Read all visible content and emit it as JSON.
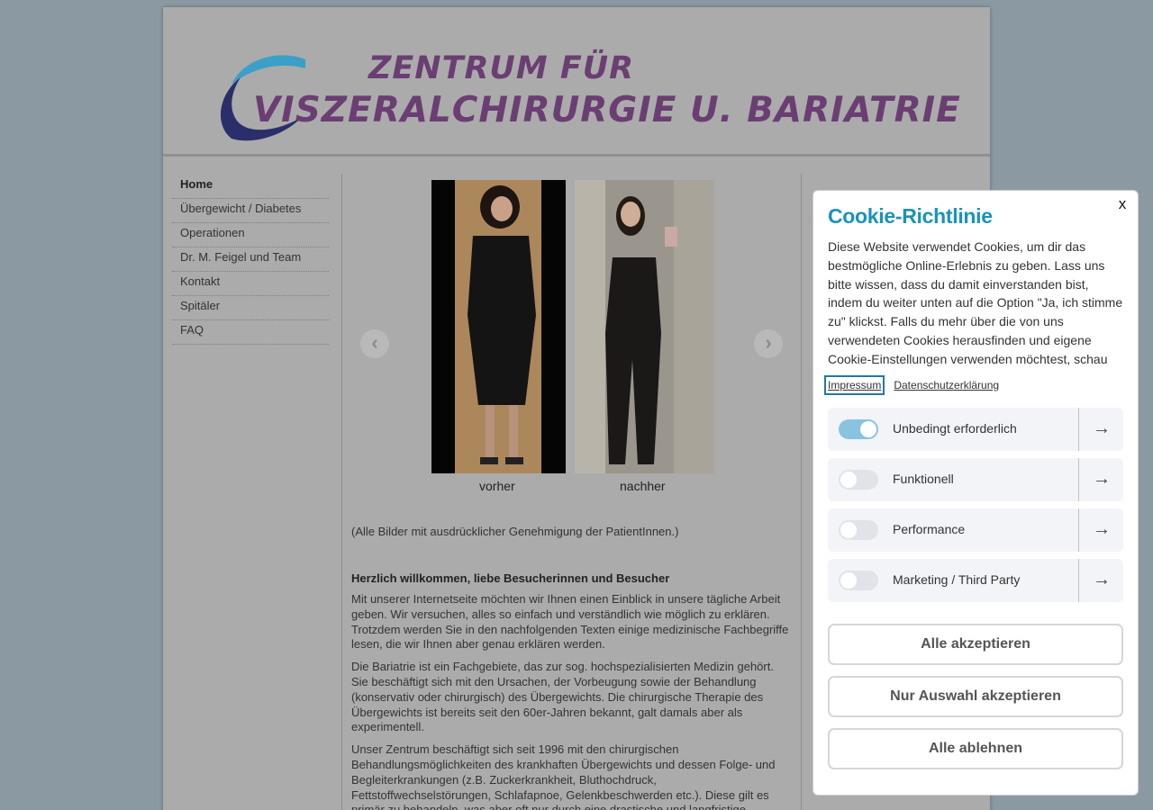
{
  "logo": {
    "line1": "ZENTRUM FÜR",
    "line2": "VISZERALCHIRURGIE U. BARIATRIE",
    "colors": {
      "text": "#6b3e73",
      "swoosh_light": "#3aa0c8",
      "swoosh_dark": "#2a2e6b"
    }
  },
  "nav": {
    "items": [
      {
        "label": "Home",
        "active": true
      },
      {
        "label": "Übergewicht / Diabetes"
      },
      {
        "label": "Operationen"
      },
      {
        "label": "Dr. M. Feigel und Team"
      },
      {
        "label": "Kontakt"
      },
      {
        "label": "Spitäler"
      },
      {
        "label": "FAQ"
      }
    ]
  },
  "gallery": {
    "before_label": "vorher",
    "after_label": "nachher",
    "prev_icon": "chevron-left-icon",
    "next_icon": "chevron-right-icon"
  },
  "content": {
    "caption": "(Alle Bilder mit ausdrücklicher Genehmigung der PatientInnen.)",
    "welcome_title": "Herzlich willkommen, liebe Besucherinnen und Besucher",
    "paragraphs": [
      "Mit unserer Internetseite möchten wir Ihnen einen Einblick in unsere tägliche Arbeit geben. Wir versuchen, alles so einfach und verständlich wie möglich zu erklären. Trotzdem werden Sie in den nachfolgenden Texten einige medizinische Fachbegriffe lesen, die wir Ihnen aber genau erklären werden.",
      "Die Bariatrie ist ein Fachgebiete, das zur sog. hochspezialisierten Medizin gehört. Sie beschäftigt sich mit den Ursachen, der Vorbeugung sowie der Behandlung (konservativ oder chirurgisch) des Übergewichts. Die chirurgische Therapie des Übergewichts ist bereits seit den 60er-Jahren bekannt, galt damals aber als experimentell.",
      "Unser Zentrum beschäftigt sich seit 1996 mit den chirurgischen Behandlungsmöglichkeiten des krankhaften Übergewichts und dessen Folge- und Begleiterkrankungen (z.B. Zuckerkrankheit, Bluthochdruck, Fettstoffwechselstörungen, Schlafapnoe, Gelenkbeschwerden etc.). Diese gilt es primär zu behandeln, was aber oft nur durch eine drastische und langfristige"
    ]
  },
  "cookie": {
    "close_label": "x",
    "title": "Cookie-Richtlinie",
    "text": "Diese Website verwendet Cookies, um dir das bestmögliche Online-Erlebnis zu geben. Lass uns bitte wissen, dass du damit einverstanden bist, indem du weiter unten auf die Option \"Ja, ich stimme zu\" klickst. Falls du mehr über die von uns verwendeten Cookies herausfinden und eigene Cookie-Einstellungen verwenden möchtest, schau",
    "link_impressum": "Impressum",
    "link_privacy": "Datenschutzerklärung",
    "categories": [
      {
        "label": "Unbedingt erforderlich",
        "enabled": true
      },
      {
        "label": "Funktionell",
        "enabled": false
      },
      {
        "label": "Performance",
        "enabled": false
      },
      {
        "label": "Marketing / Third Party",
        "enabled": false
      }
    ],
    "arrow_glyph": "→",
    "accept_all": "Alle akzeptieren",
    "accept_selection": "Nur Auswahl akzeptieren",
    "reject_all": "Alle ablehnen",
    "accent_color": "#1a93b8"
  }
}
